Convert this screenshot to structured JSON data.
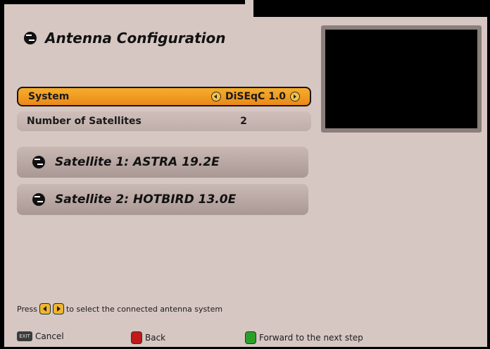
{
  "header": {
    "title": "Antenna Configuration"
  },
  "settings": {
    "system": {
      "label": "System",
      "value": "DiSEqC 1.0"
    },
    "satellites": {
      "label": "Number of Satellites",
      "value": "2"
    }
  },
  "satellite_list": [
    {
      "label": "Satellite 1: ASTRA 19.2E"
    },
    {
      "label": "Satellite 2: HOTBIRD 13.0E"
    }
  ],
  "hint": {
    "prefix": "Press",
    "suffix": "to select the connected antenna system"
  },
  "footer": {
    "cancel": "Cancel",
    "exit_key": "EXIT",
    "back": "Back",
    "forward": "Forward to the next step"
  },
  "colors": {
    "background": "#d6c7c2",
    "highlight": "#f0a027",
    "red_key": "#c11a1a",
    "green_key": "#2aa02a"
  }
}
